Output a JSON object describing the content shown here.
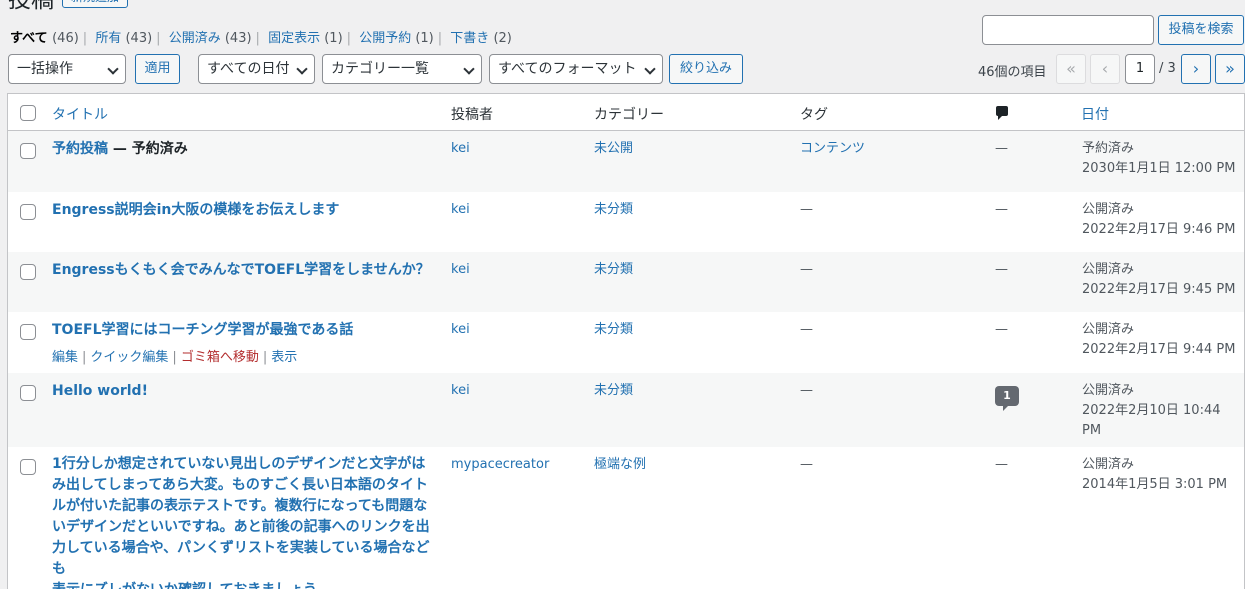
{
  "header": {
    "title": "投稿",
    "add_new": "新規追加"
  },
  "views": [
    {
      "label": "すべて",
      "count": "(46)",
      "current": true
    },
    {
      "label": "所有",
      "count": "(43)"
    },
    {
      "label": "公開済み",
      "count": "(43)"
    },
    {
      "label": "固定表示",
      "count": "(1)"
    },
    {
      "label": "公開予約",
      "count": "(1)"
    },
    {
      "label": "下書き",
      "count": "(2)"
    }
  ],
  "search": {
    "value": "",
    "button": "投稿を検索"
  },
  "tablenav": {
    "bulk_action": "一括操作",
    "apply": "適用",
    "date_filter": "すべての日付",
    "category_filter": "カテゴリー一覧",
    "format_filter": "すべてのフォーマット",
    "filter_button": "絞り込み",
    "items_count": "46個の項目",
    "first": "«",
    "prev": "‹",
    "current_page": "1",
    "total_pages": "/ 3",
    "next": "›",
    "last": "»"
  },
  "columns": {
    "title": "タイトル",
    "author": "投稿者",
    "categories": "カテゴリー",
    "tags": "タグ",
    "comments_icon": "comment-icon",
    "date": "日付"
  },
  "posts": [
    {
      "title": "予約投稿",
      "state": " — 予約済み",
      "author": "kei",
      "category": "未公開",
      "tags": "コンテンツ",
      "comments": "—",
      "status": "予約済み",
      "date": "2030年1月1日 12:00 PM"
    },
    {
      "title": "Engress説明会in大阪の模様をお伝えします",
      "author": "kei",
      "category": "未分類",
      "tags": "—",
      "comments": "—",
      "status": "公開済み",
      "date": "2022年2月17日 9:46 PM"
    },
    {
      "title": "Engressもくもく会でみんなでTOEFL学習をしませんか？",
      "author": "kei",
      "category": "未分類",
      "tags": "—",
      "comments": "—",
      "status": "公開済み",
      "date": "2022年2月17日 9:45 PM"
    },
    {
      "title": "TOEFL学習にはコーチング学習が最強である話",
      "author": "kei",
      "category": "未分類",
      "tags": "—",
      "comments": "—",
      "status": "公開済み",
      "date": "2022年2月17日 9:44 PM",
      "actions": {
        "edit": "編集",
        "quick_edit": "クイック編集",
        "trash": "ゴミ箱へ移動",
        "view": "表示"
      }
    },
    {
      "title": "Hello world!",
      "author": "kei",
      "category": "未分類",
      "tags": "—",
      "comments": "1",
      "status": "公開済み",
      "date": "2022年2月10日 10:44",
      "date2": "PM"
    },
    {
      "title_lines": [
        "1行分しか想定されていない見出しのデザインだと文字がは",
        "み出してしまってあら大変。ものすごく長い日本語のタイト",
        "ルが付いた記事の表示テストです。複数行になっても問題な",
        "いデザインだといいですね。あと前後の記事へのリンクを出",
        "力している場合や、パンくずリストを実装している場合なども",
        "表示にズレがないか確認しておきましょう。"
      ],
      "author": "mypacecreator",
      "category": "極端な例",
      "tags": "—",
      "comments": "—",
      "status": "公開済み",
      "date": "2014年1月5日 3:01 PM"
    }
  ]
}
